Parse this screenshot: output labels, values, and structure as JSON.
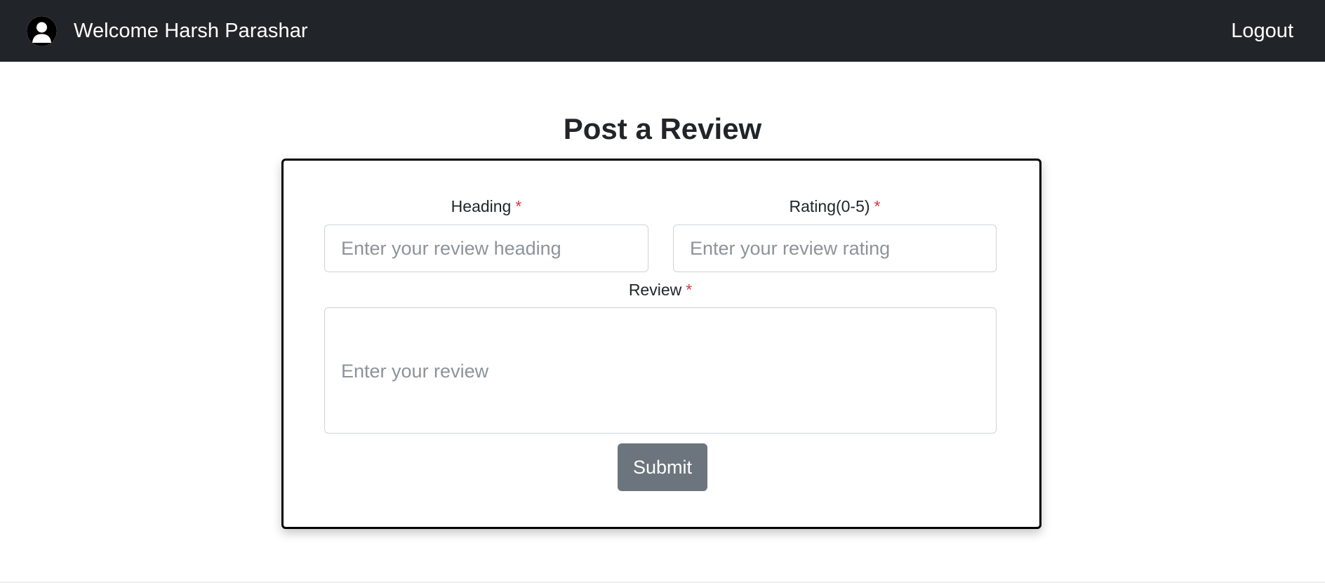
{
  "navbar": {
    "avatar_icon": "user-circle-icon",
    "welcome_text": "Welcome Harsh Parashar",
    "logout_label": "Logout",
    "background": "#212529"
  },
  "page": {
    "title": "Post a Review"
  },
  "form": {
    "heading": {
      "label": "Heading",
      "required_mark": "*",
      "value": "",
      "placeholder": "Enter your review heading"
    },
    "rating": {
      "label": "Rating(0-5)",
      "required_mark": "*",
      "value": "",
      "placeholder": "Enter your review rating"
    },
    "review": {
      "label": "Review",
      "required_mark": "*",
      "value": "",
      "placeholder": "Enter your review"
    },
    "submit_label": "Submit",
    "submit_color": "#6c757d",
    "required_color": "#dc3545"
  }
}
